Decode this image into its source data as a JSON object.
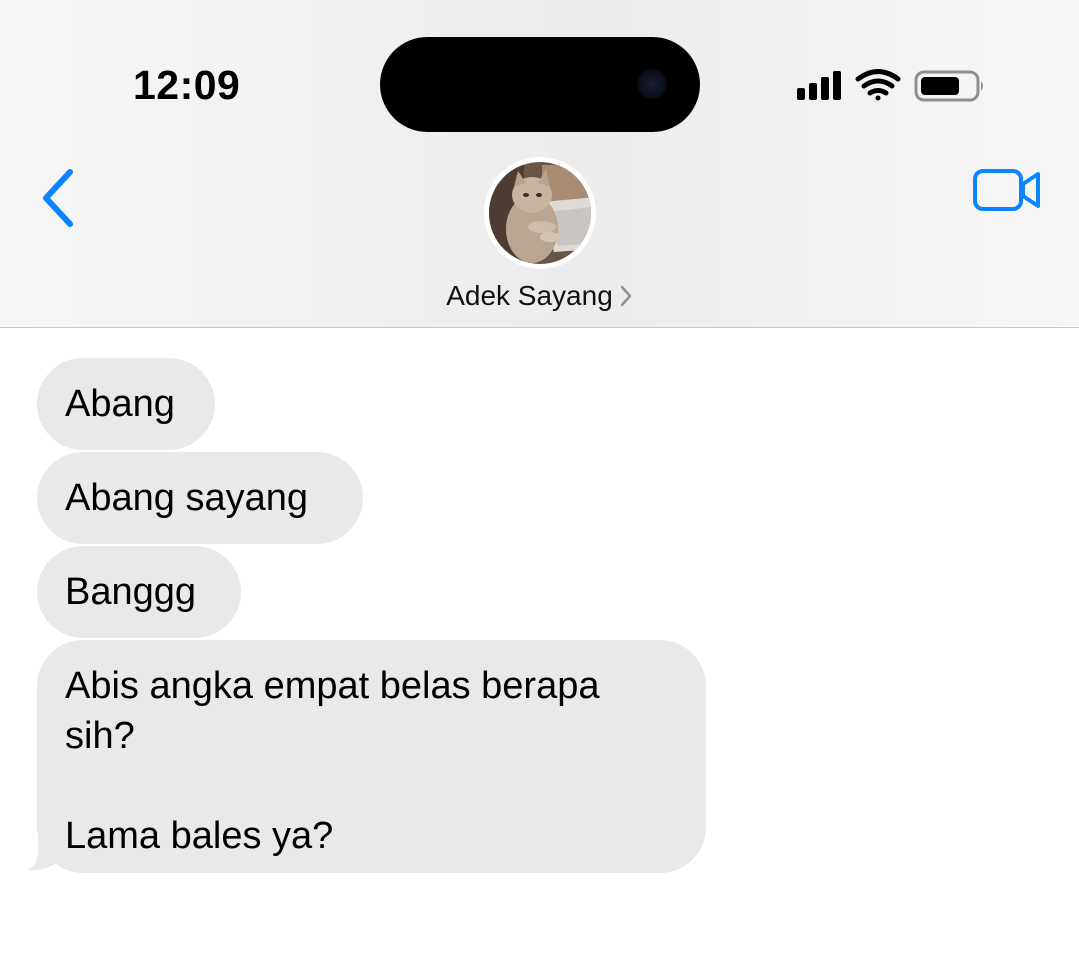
{
  "status_bar": {
    "time": "12:09",
    "icons": [
      "cellular-signal-icon",
      "wifi-icon",
      "battery-icon"
    ]
  },
  "header": {
    "back_icon": "chevron-left-icon",
    "video_icon": "video-camera-icon",
    "contact_name": "Adek Sayang",
    "contact_chevron_icon": "chevron-right-icon"
  },
  "messages": [
    {
      "text": "Abang"
    },
    {
      "text": "Abang sayang"
    },
    {
      "text": "Banggg"
    },
    {
      "text_line1": "Abis angka empat belas berapa",
      "text_line2": "sih?",
      "text_line3": "Lama bales ya?"
    }
  ],
  "colors": {
    "accent": "#0a84ff",
    "bubble_incoming": "#e9e9eb",
    "text": "#000000"
  }
}
